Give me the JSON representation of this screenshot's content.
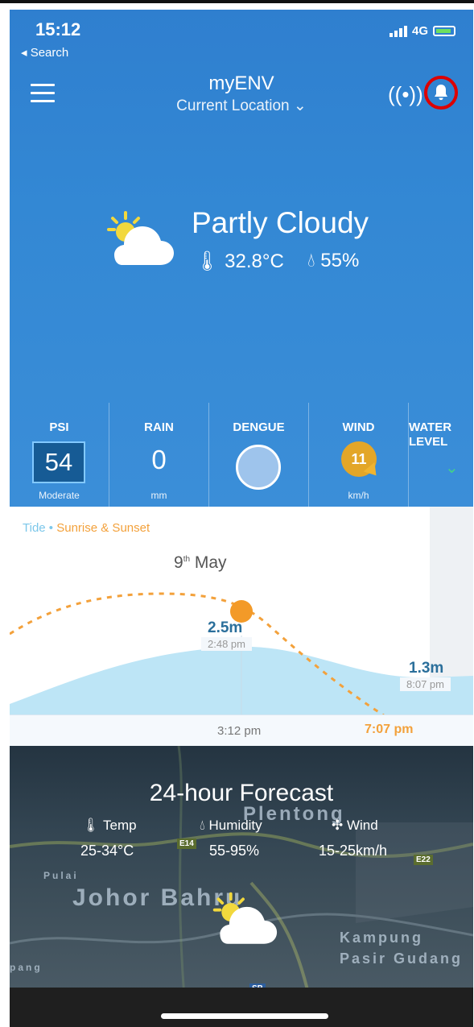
{
  "status": {
    "time": "15:12",
    "back": "◂ Search",
    "network": "4G"
  },
  "header": {
    "title": "myENV",
    "location": "Current Location ⌄"
  },
  "current": {
    "condition": "Partly Cloudy",
    "temperature": "32.8°C",
    "humidity": "55%"
  },
  "metrics": [
    {
      "label": "PSI",
      "value": "54",
      "sub": "Moderate"
    },
    {
      "label": "RAIN",
      "value": "0",
      "sub": "mm"
    },
    {
      "label": "DENGUE",
      "value": "",
      "sub": ""
    },
    {
      "label": "WIND",
      "value": "11",
      "sub": "km/h"
    },
    {
      "label": "WATER LEVEL",
      "value": "",
      "sub": ""
    }
  ],
  "tide": {
    "legend_tide": "Tide",
    "legend_dot": "•",
    "legend_sun": "Sunrise & Sunset",
    "date_day": "9",
    "date_suffix": "th",
    "date_month": "May",
    "high_height": "2.5m",
    "high_time": "2:48 pm",
    "low_height": "1.3m",
    "low_time": "8:07 pm",
    "now_time": "3:12 pm",
    "sunset_time": "7:07 pm"
  },
  "forecast": {
    "title": "24-hour Forecast",
    "temp_label": "Temp",
    "temp_value": "25-34°C",
    "humidity_label": "Humidity",
    "humidity_value": "55-95%",
    "wind_label": "Wind",
    "wind_value": "15-25km/h",
    "map_labels": [
      "Plentong",
      "Johor Bahru",
      "Kampung",
      "Pasir Gudang",
      "Pulai",
      "pang"
    ],
    "road_labels": [
      "E14",
      "E22",
      "SB"
    ]
  },
  "colors": {
    "hero": "#3388d4",
    "alert_ring": "#dd0000",
    "sun": "#f39a28",
    "tide": "#7cc7ea"
  }
}
